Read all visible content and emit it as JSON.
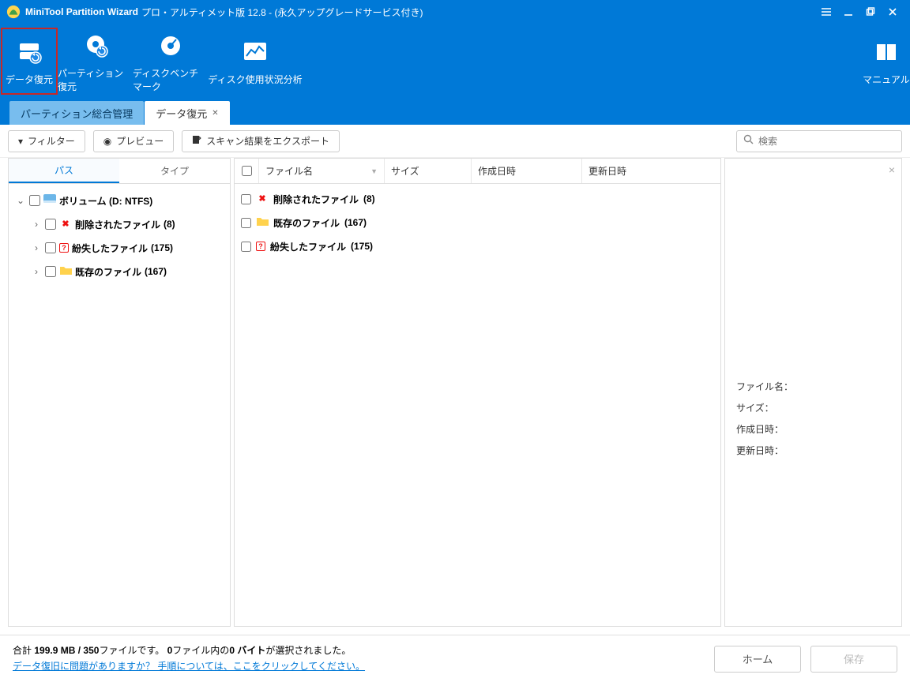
{
  "title": {
    "product": "MiniTool Partition Wizard",
    "edition": "プロ・アルティメット版  12.8 - (永久アップグレードサービス付き)"
  },
  "ribbon": {
    "data_recovery": "データ復元",
    "partition_recovery": "パーティション復元",
    "disk_benchmark": "ディスクベンチマーク",
    "disk_usage": "ディスク使用状況分析",
    "manual": "マニュアル"
  },
  "tabs": {
    "partition_mgmt": "パーティション総合管理",
    "data_recovery": "データ復元"
  },
  "actions": {
    "filter": "フィルター",
    "preview": "プレビュー",
    "export": "スキャン結果をエクスポート",
    "search_placeholder": "検索"
  },
  "left_tabs": {
    "path": "パス",
    "type": "タイプ"
  },
  "tree": {
    "volume": "ボリューム (D: NTFS)",
    "deleted": "削除されたファイル",
    "deleted_count": "(8)",
    "lost": "紛失したファイル",
    "lost_count": "(175)",
    "existing": "既存のファイル",
    "existing_count": "(167)"
  },
  "columns": {
    "name": "ファイル名",
    "size": "サイズ",
    "created": "作成日時",
    "modified": "更新日時"
  },
  "files": {
    "deleted": "削除されたファイル",
    "deleted_count": "(8)",
    "existing": "既存のファイル",
    "existing_count": "(167)",
    "lost": "紛失したファイル",
    "lost_count": "(175)"
  },
  "details": {
    "name": "ファイル名：",
    "size": "サイズ：",
    "created": "作成日時：",
    "modified": "更新日時："
  },
  "footer": {
    "summary_prefix": "合計",
    "summary_size": "199.9 MB",
    "summary_sep": "/",
    "summary_files": "350",
    "summary_files_suffix": "ファイルです。",
    "selected_files_prefix1": "0",
    "selected_files_mid": "ファイル内の",
    "selected_bytes": "0 バイト",
    "selected_suffix": "が選択されました。",
    "help": "データ復旧に問題がありますか？ 手順については、ここをクリックしてください。",
    "home": "ホーム",
    "save": "保存"
  }
}
